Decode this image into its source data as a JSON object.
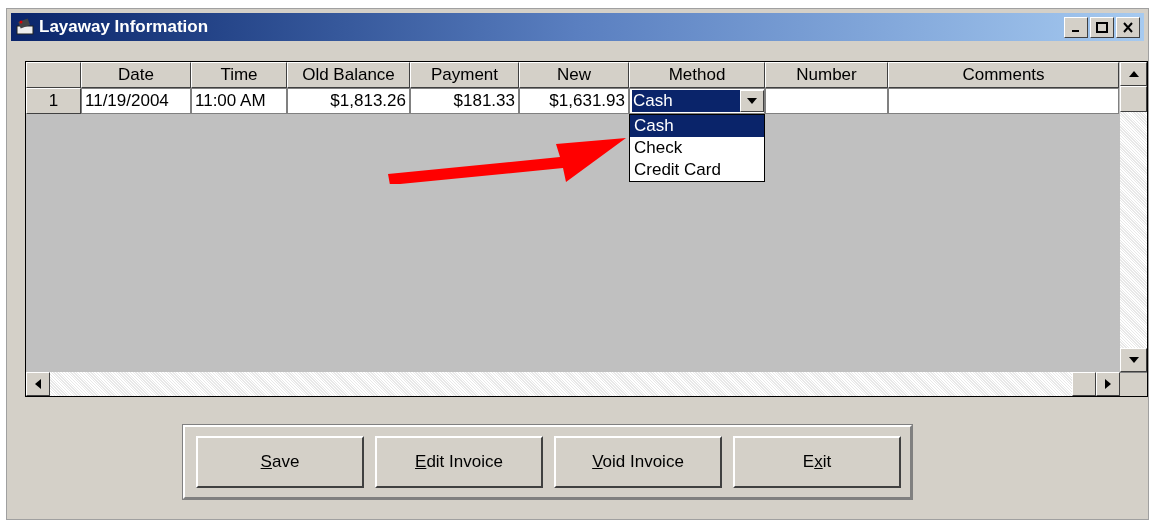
{
  "window": {
    "title": "Layaway Information"
  },
  "table": {
    "columns": [
      "Date",
      "Time",
      "Old Balance",
      "Payment",
      "New",
      "Method",
      "Number",
      "Comments"
    ],
    "rows": [
      {
        "row_header": "1",
        "date": "11/19/2004",
        "time": "11:00 AM",
        "old_balance": "$1,813.26",
        "payment": "$181.33",
        "new": "$1,631.93",
        "method": "Cash",
        "number": "",
        "comments": ""
      }
    ]
  },
  "method_dropdown": {
    "expanded": true,
    "options": [
      {
        "label": "Cash",
        "selected": true
      },
      {
        "label": "Check",
        "selected": false
      },
      {
        "label": "Credit Card",
        "selected": false
      }
    ]
  },
  "buttons": [
    {
      "label_key": "S",
      "label_after": "ave"
    },
    {
      "label_key": "E",
      "label_after": "dit Invoice"
    },
    {
      "label_key": "V",
      "label_after": "oid Invoice"
    },
    {
      "label_before": "E",
      "label_key": "x",
      "label_after": "it"
    }
  ]
}
